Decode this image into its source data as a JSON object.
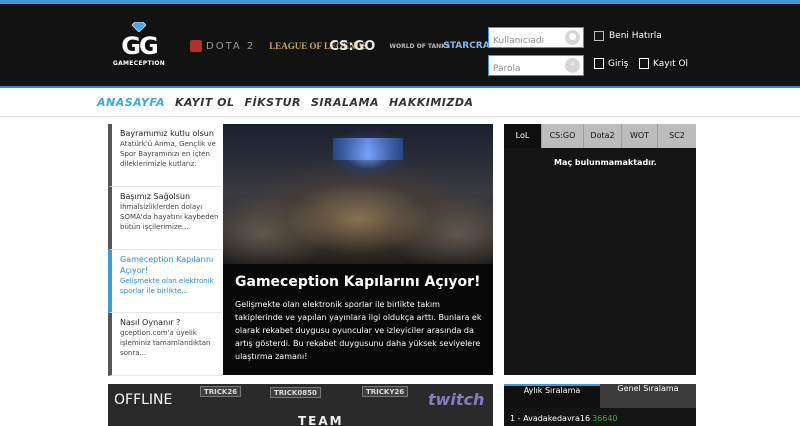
{
  "brand": {
    "logo_mark": "GG",
    "logo_word": "GAMECEPTION"
  },
  "games": [
    "DOTA 2",
    "LEAGUE OF LEGENDS",
    "CS:GO",
    "WORLD OF TANKS",
    "STARCRAFT II"
  ],
  "login": {
    "username_placeholder": "Kullanıcıadı",
    "password_placeholder": "Parola",
    "remember_label": "Beni Hatırla",
    "login_label": "Giriş",
    "register_label": "Kayıt Ol"
  },
  "nav": {
    "items": [
      "ANASAYFA",
      "KAYIT OL",
      "FİKSTUR",
      "SIRALAMA",
      "HAKKIMIZDA"
    ],
    "active": 0
  },
  "news": [
    {
      "title": "Bayramımız kutlu olsun",
      "body": "Atatürk'ü Anma, Gençlik ve Spor Bayramınızı en içten dileklerimizle kutlarız."
    },
    {
      "title": "Başımız Sağolsun",
      "body": "İhmalsizliklerden dolayı SOMA'da hayatını kaybeden bütün işçilerimize..."
    },
    {
      "title": "Gameception Kapılarını Açıyor!",
      "body": "Gelişmekte olan elektronik sporlar ile birlikte..."
    },
    {
      "title": "Nasıl Oynanır ?",
      "body": "gception.com'a üyelik işleminiz tamamlandıktan sonra..."
    }
  ],
  "feature": {
    "title": "Gameception Kapılarını Açıyor!",
    "body": "Gelişmekte olan elektronik sporlar ile birlikte takım takiplerinde ve yapılan yayınlara ilgi oldukça arttı. Bunlara ek olarak rekabet duygusu oyuncular ve izleyiciler arasında da artış gösterdi. Bu rekabet duygusunu daha yüksek seviyelere ulaştırma zamanı!"
  },
  "matches": {
    "tabs": [
      "LoL",
      "CS:GO",
      "Dota2",
      "WOT",
      "SC2"
    ],
    "active_tab": 0,
    "empty_message": "Maç bulunmamaktadır."
  },
  "stream": {
    "status": "OFFLINE",
    "tags": [
      "TRICK26",
      "TRICK0850",
      "TRICKY26"
    ],
    "platform": "twitch",
    "team": "TEAM"
  },
  "ranking": {
    "tabs": [
      "Aylık Sıralama",
      "Genel Sıralama"
    ],
    "active_tab": 0,
    "rows": [
      {
        "rank": "1 -",
        "name": "Avadakedavra16",
        "points": "36640"
      }
    ]
  },
  "colors": {
    "accent": "#3a9bd6",
    "header_bg": "#121212",
    "points_green": "#3fb23f"
  }
}
